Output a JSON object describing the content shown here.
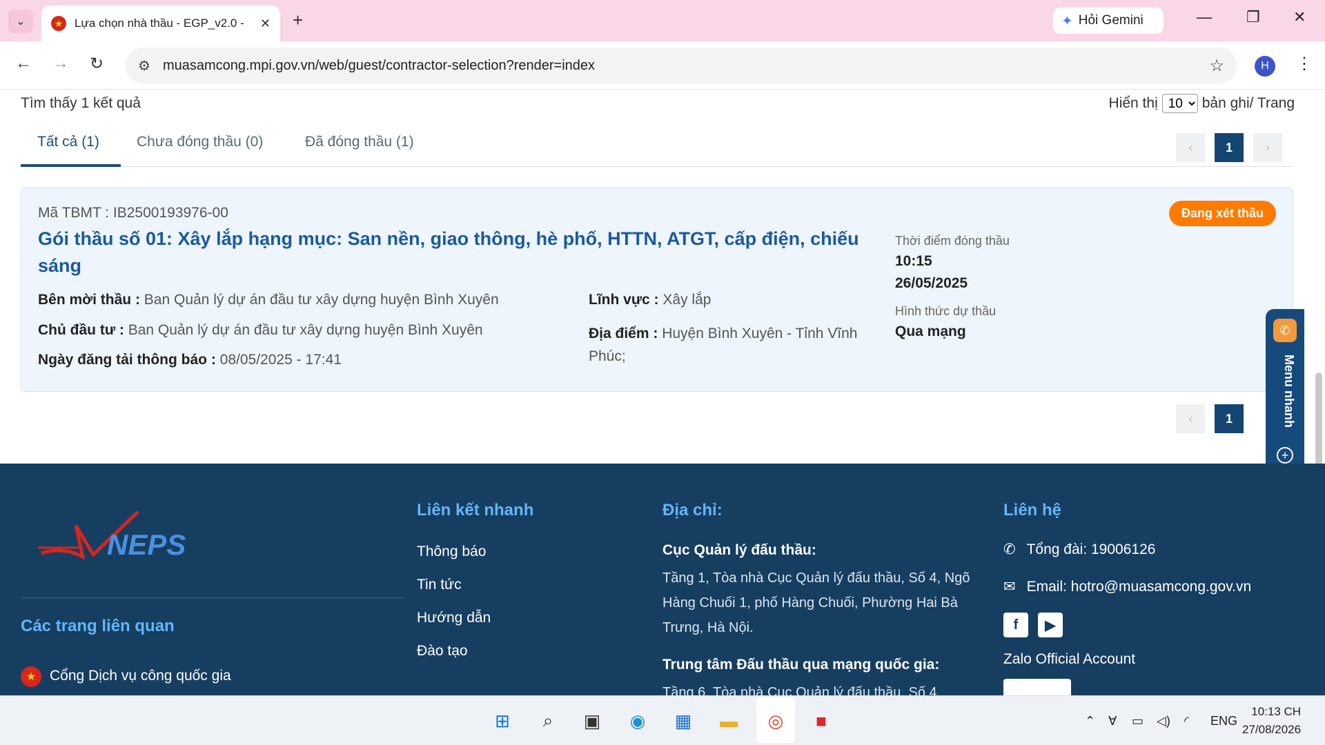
{
  "browser": {
    "tab_title": "Lựa chọn nhà thầu - EGP_v2.0 -",
    "url": "muasamcong.mpi.gov.vn/web/guest/contractor-selection?render=index",
    "gemini_label": "Hỏi Gemini",
    "profile_initial": "H"
  },
  "results": {
    "count_text": "Tìm thấy 1 kết quả",
    "per_page_prefix": "Hiển thị",
    "per_page_value": "10",
    "per_page_suffix": "bản ghi/ Trang"
  },
  "tabs": [
    {
      "label": "Tất cả (1)",
      "active": true
    },
    {
      "label": "Chưa đóng thầu (0)",
      "active": false
    },
    {
      "label": "Đã đóng thầu (1)",
      "active": false
    }
  ],
  "pagination": {
    "current_page": "1",
    "prev": "‹",
    "next": "›"
  },
  "tender": {
    "code": "Mã TBMT : IB2500193976-00",
    "title": "Gói thầu số 01: Xây lắp hạng mục: San nền, giao thông, hè phố, HTTN, ATGT, cấp điện, chiếu sáng",
    "status": "Đang xét thầu",
    "procuring_label": "Bên mời thầu :",
    "procuring_value": "Ban Quản lý dự án đầu tư xây dựng huyện Bình Xuyên",
    "investor_label": "Chủ đầu tư :",
    "investor_value": "Ban Quản lý dự án đầu tư xây dựng huyện Bình Xuyên",
    "posted_label": "Ngày đăng tải thông báo :",
    "posted_value": "08/05/2025 - 17:41",
    "field_label": "Lĩnh vực :",
    "field_value": "Xây lắp",
    "location_label": "Địa điểm :",
    "location_value": "Huyện Bình Xuyên - Tỉnh Vĩnh Phúc;",
    "closing_label": "Thời điểm đóng thầu",
    "closing_time": "10:15",
    "closing_date": "26/05/2025",
    "bid_method_label": "Hình thức dự thầu",
    "bid_method_value": "Qua mạng"
  },
  "quick_menu": {
    "label": "Menu nhanh"
  },
  "footer": {
    "related_title": "Các trang liên quan",
    "related_item": "Cổng Dịch vụ công quốc gia",
    "quick_links_title": "Liên kết nhanh",
    "quick_links": [
      "Thông báo",
      "Tin tức",
      "Hướng dẫn",
      "Đào tạo"
    ],
    "address_title": "Địa chỉ:",
    "org1_name": "Cục Quản lý đấu thầu:",
    "org1_address": "Tầng 1, Tòa nhà Cục Quản lý đấu thầu, Số 4, Ngõ Hàng Chuối 1, phố Hàng Chuối, Phường Hai Bà Trưng, Hà Nội.",
    "org2_name": "Trung tâm Đấu thầu qua mạng quốc gia:",
    "org2_address": "Tầng 6, Tòa nhà Cục Quản lý đấu thầu, Số 4",
    "contact_title": "Liên hệ",
    "hotline": "Tổng đài: 19006126",
    "email": "Email: hotro@muasamcong.gov.vn",
    "zalo": "Zalo Official Account"
  },
  "taskbar": {
    "lang": "ENG",
    "time": "10:13 CH",
    "date": "27/08/2026"
  },
  "colors": {
    "primary": "#154673",
    "title_blue": "#1a5aa0",
    "status_orange": "#ff7a00",
    "footer_bg": "#163e61",
    "footer_heading": "#64b5f6",
    "tabstrip": "#f9d7e6"
  }
}
